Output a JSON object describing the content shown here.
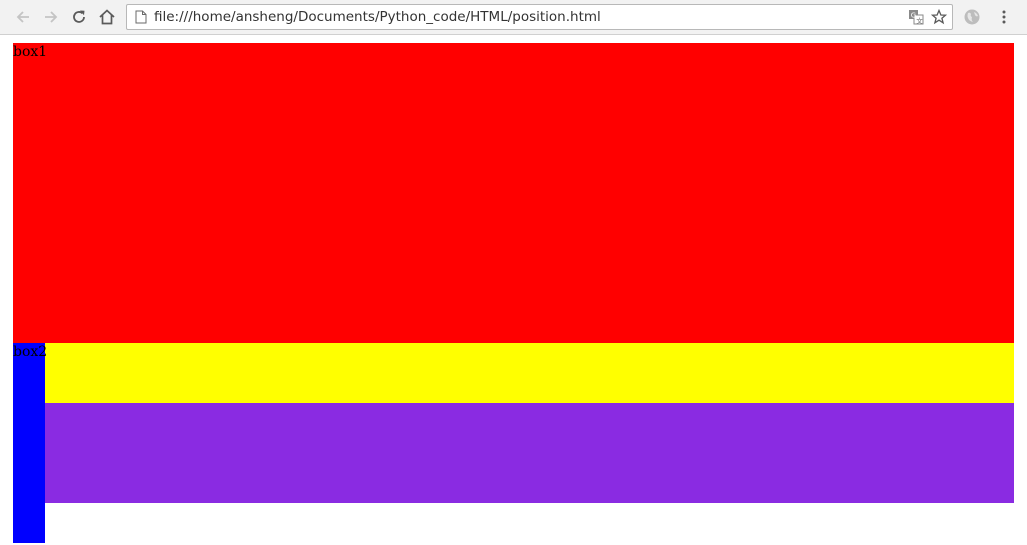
{
  "browser": {
    "url": "file:///home/ansheng/Documents/Python_code/HTML/position.html",
    "icons": {
      "back": "arrow-left-icon",
      "forward": "arrow-right-icon",
      "reload": "reload-icon",
      "home": "home-icon",
      "page": "file-page-icon",
      "translate": "translate-icon",
      "bookmark": "star-icon",
      "extension": "globe-icon",
      "menu": "three-dot-menu-icon"
    }
  },
  "page": {
    "box1": {
      "label": "box1",
      "color": "#ff0000"
    },
    "box2": {
      "label": "box2",
      "color": "#0000ff"
    },
    "yellow_box": {
      "color": "#ffff00"
    },
    "purple_box": {
      "color": "#8a2be2"
    }
  }
}
